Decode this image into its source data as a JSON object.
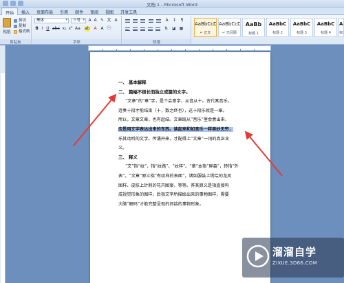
{
  "window": {
    "title": "文档 1 - Microsoft Word"
  },
  "tabs": [
    {
      "label": "开始",
      "active": true
    },
    {
      "label": "插入",
      "active": false
    },
    {
      "label": "页面布局",
      "active": false
    },
    {
      "label": "引用",
      "active": false
    },
    {
      "label": "邮件",
      "active": false
    },
    {
      "label": "审阅",
      "active": false
    },
    {
      "label": "视图",
      "active": false
    },
    {
      "label": "开发工具",
      "active": false
    }
  ],
  "ribbon": {
    "clipboard": {
      "paste_label": "粘贴",
      "cut_label": "剪切",
      "copy_label": "复制",
      "format_painter_label": "格式刷",
      "group_label": "剪贴板"
    },
    "font": {
      "font_name": "黑体",
      "font_size": "三号",
      "group_label": "字体"
    },
    "paragraph": {
      "group_label": "段落"
    },
    "styles": [
      {
        "sample": "AaBbCcDd",
        "name": "↵ 正文",
        "active": true
      },
      {
        "sample": "AaBbCcDd",
        "name": "↵ 无间隔",
        "active": false
      },
      {
        "sample": "AaBb",
        "name": "标题 1",
        "active": false
      },
      {
        "sample": "AaBbC",
        "name": "标题 2",
        "active": false
      },
      {
        "sample": "AaBbC",
        "name": "标题 3",
        "active": false
      },
      {
        "sample": "AaBbC",
        "name": "标题 4",
        "active": false
      },
      {
        "sample": "AaBb",
        "name": "标题",
        "active": false
      }
    ]
  },
  "document": {
    "heading1": "一、  基本解释",
    "heading2": "二、  篇幅不很长而独立成篇的文字。",
    "p1_line1": "“文章”的“章”字，是个会意字，从音从十。古代奏音乐，",
    "p1_line2": "连奏十段才能结束（十，数之终也），这十段乐就是一章。",
    "p1_line3": "所以，文章文章，也有起结。文章既从“音乐”里会意出来，",
    "p1_line4_highlight": "应是用文字表达出来的东西。读起来和如音乐一样美妙无穷，",
    "p1_line5": "乐其动听的文字。传诵开来，才配得上“文章”一词的真正含",
    "p1_line6": "义。",
    "heading3": "三、  释义",
    "p2_line1": "“文”指“纹”，指“纹路”、“纹样”。“章”本指“屏森”，转指“外",
    "p2_line2": "表”。“文章”原义指“有纹样的表面”，诸如服装上绣绘的龙凤",
    "p2_line3": "图样、皮肤上针刺的花卉图案，等等。荞其原义是指直接构",
    "p2_line4": "成视觉形象的图样，后指文字所描绘出来的事物图样，需要",
    "p2_line5": "大脑“解码”才能完整呈现的间接的事物形象。"
  },
  "watermark": {
    "name": "溜溜自学",
    "url": "ZIXUE.3D66.COM"
  },
  "colors": {
    "arrow": "#e53935",
    "highlight": "#bcd4f2",
    "background": "#6d8fbd"
  }
}
